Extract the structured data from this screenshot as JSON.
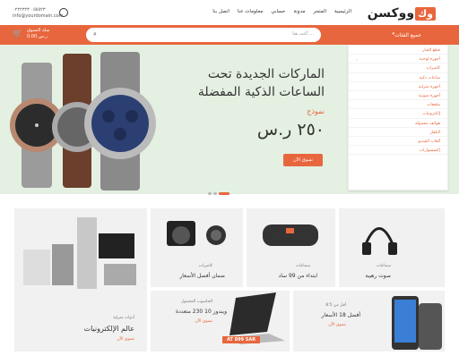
{
  "brand": {
    "mark": "وك",
    "name": "ووكسن"
  },
  "nav": [
    "الرئيسية",
    "المتجر",
    "مدونة",
    "حسابي",
    "معلومات عنا",
    "اتصل بنا"
  ],
  "contact": {
    "phone": "٠٥٥٥٢٣ ٠٢٢٢٣٢٣",
    "email": "info@yourdomain.com"
  },
  "search": {
    "placeholder": "أكتب هنا ...",
    "icon": "search-icon"
  },
  "categories_label": "جميع الفئات",
  "cart": {
    "label": "سلة التسوق",
    "total": "0.00 ر.س"
  },
  "hero": {
    "line1": "الماركات الجديدة تحت",
    "line2": "الساعات الذكية المفضلة",
    "model": "نموذج",
    "price": "٢٥٠ ر.س",
    "cta": "تسوق الآن"
  },
  "menu": [
    "قطع الغيار",
    "أجهزة لوحية",
    "كاميرات",
    "ساعات ذكية",
    "أجهزة منزلية",
    "أجهزة صوتية",
    "ملحقات",
    "إلكترونيات",
    "هواتف محمولة",
    "التلفاز",
    "ألعاب الفيديو",
    "إكسسوارات"
  ],
  "cards": {
    "headset": {
      "sub": "سماعات",
      "title": "صوت رهيبة"
    },
    "speaker": {
      "sub": "سماعات",
      "title": "ابتداء من 99 ساد"
    },
    "camera": {
      "sub": "كاميرات",
      "title": "ضمان أفضل الأسعار"
    },
    "big": {
      "sub": "أدوات منزلية",
      "title": "عالم الإلكترونيات",
      "cta": "تسوق الآن"
    },
    "phones": {
      "sub": "أقل من 8:5",
      "title": "أفضل 18 الأسعار",
      "cta": "تسوق الآن"
    },
    "laptop": {
      "sub": "الحاسوب المحمول",
      "title": "ويندوز 10 230 متعددة",
      "cta": "تسوق الآن",
      "price": "AT 899 SAR"
    }
  },
  "colors": {
    "accent": "#e8663d",
    "hero_bg": "#e4f0e1"
  }
}
